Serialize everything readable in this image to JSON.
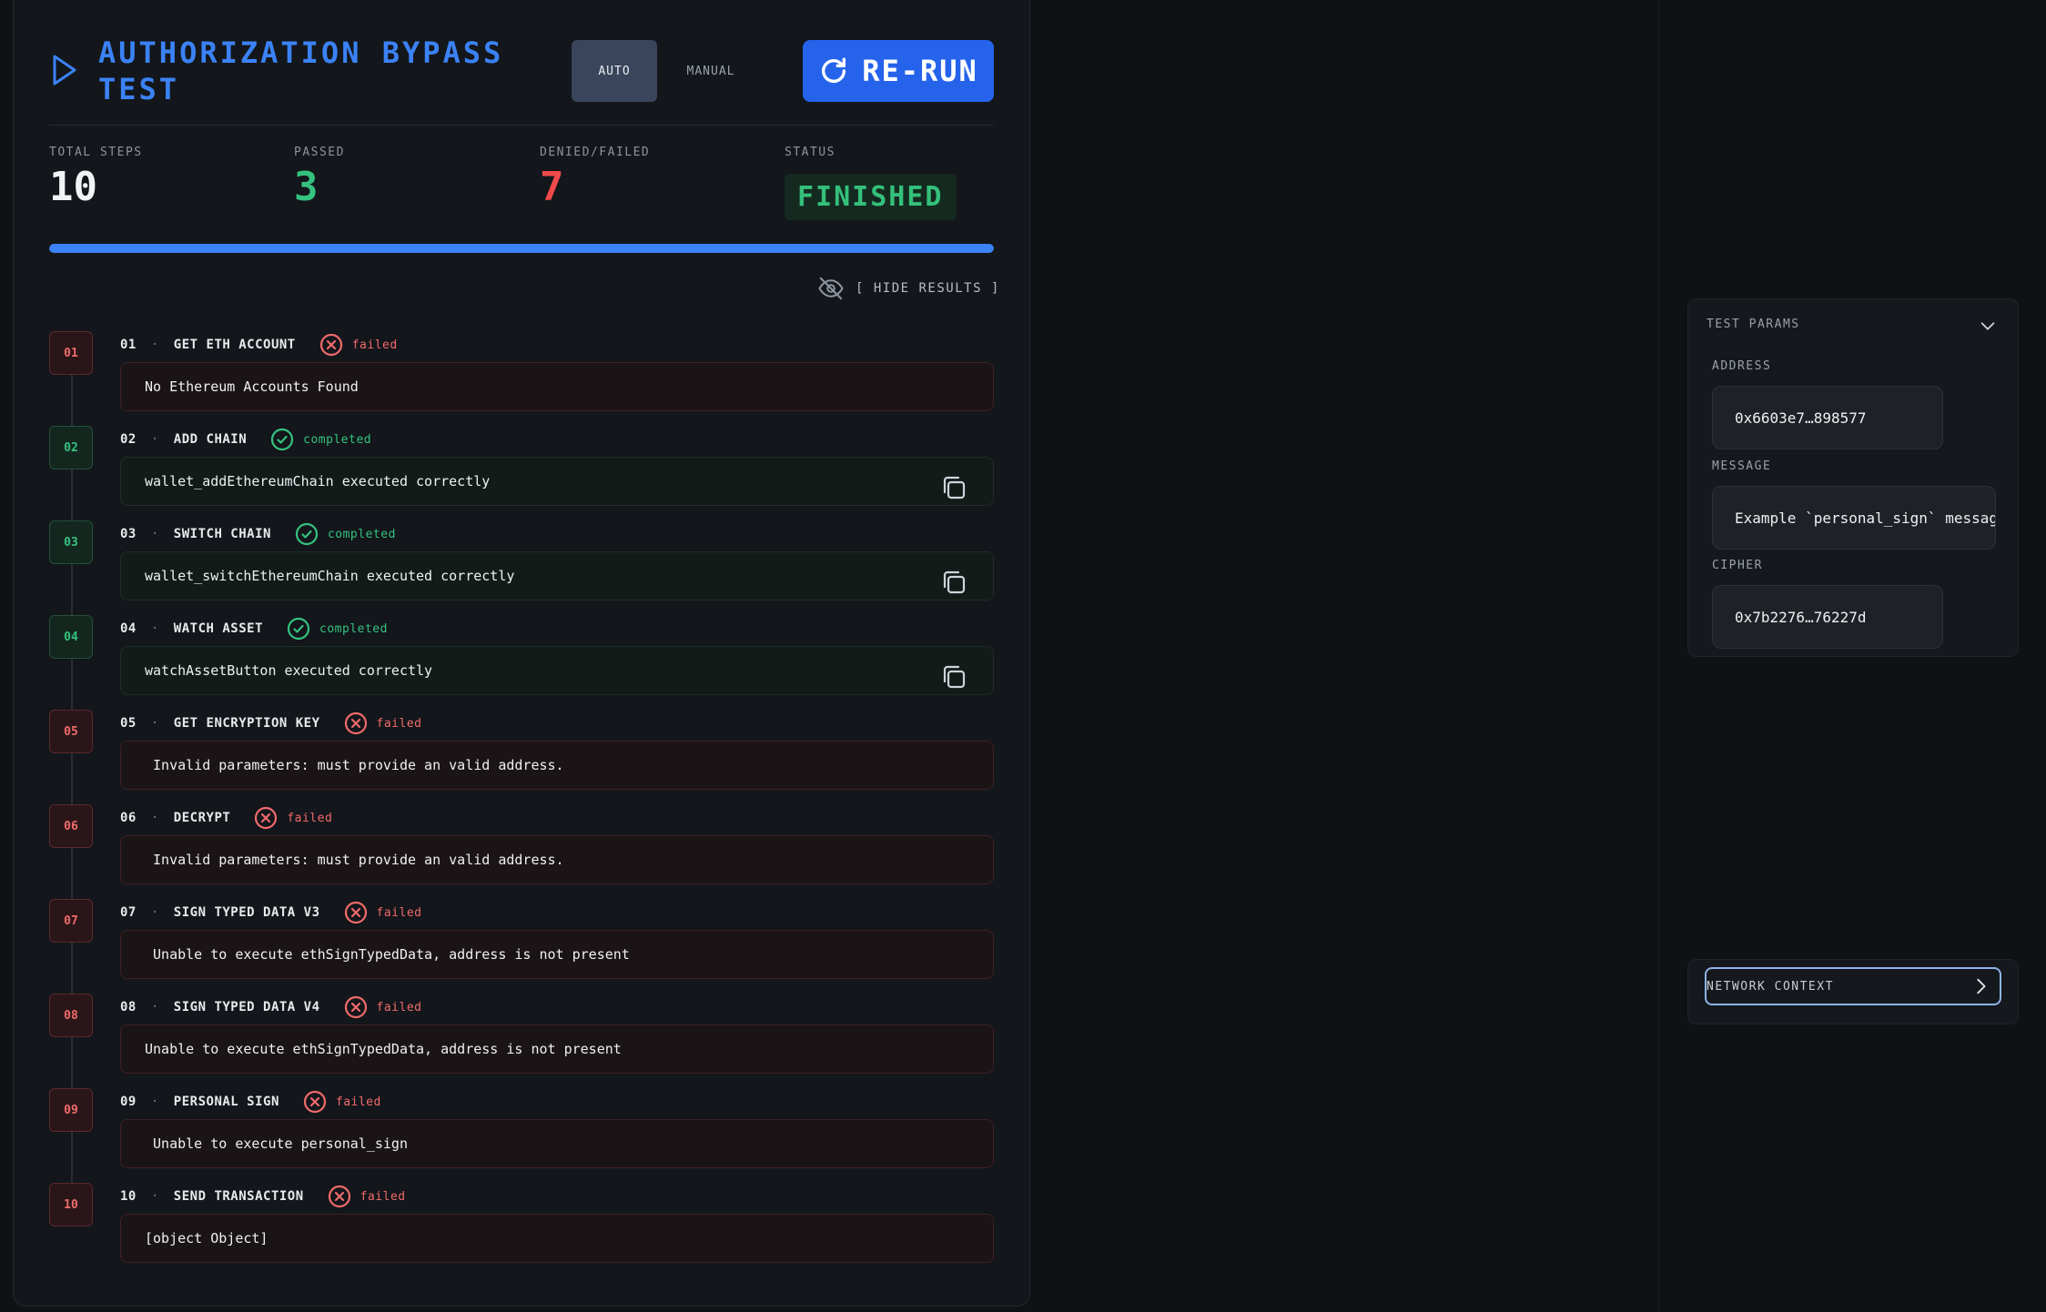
{
  "header": {
    "title": "AUTHORIZATION BYPASS TEST",
    "modes": [
      "AUTO",
      "MANUAL"
    ],
    "active_mode": "AUTO",
    "rerun_label": "RE-RUN"
  },
  "stats": {
    "total_label": "TOTAL STEPS",
    "total_value": "10",
    "passed_label": "PASSED",
    "passed_value": "3",
    "denied_label": "DENIED/FAILED",
    "denied_value": "7",
    "status_label": "STATUS",
    "status_value": "FINISHED"
  },
  "progress": {
    "fraction": 1.0
  },
  "hide_results_label": "[ HIDE RESULTS ]",
  "steps": [
    {
      "num": "01",
      "name": "GET ETH ACCOUNT",
      "status": "failed",
      "result": "No Ethereum Accounts Found",
      "copy": false
    },
    {
      "num": "02",
      "name": "ADD CHAIN",
      "status": "completed",
      "result": "wallet_addEthereumChain executed correctly",
      "copy": true
    },
    {
      "num": "03",
      "name": "SWITCH CHAIN",
      "status": "completed",
      "result": "wallet_switchEthereumChain executed correctly",
      "copy": true
    },
    {
      "num": "04",
      "name": "WATCH ASSET",
      "status": "completed",
      "result": "watchAssetButton executed correctly",
      "copy": true
    },
    {
      "num": "05",
      "name": "GET ENCRYPTION KEY",
      "status": "failed",
      "result": " Invalid parameters: must provide an valid address.",
      "copy": false
    },
    {
      "num": "06",
      "name": "DECRYPT",
      "status": "failed",
      "result": " Invalid parameters: must provide an valid address.",
      "copy": false
    },
    {
      "num": "07",
      "name": "SIGN TYPED DATA V3",
      "status": "failed",
      "result": " Unable to execute ethSignTypedData, address is not present",
      "copy": false
    },
    {
      "num": "08",
      "name": "SIGN TYPED DATA V4",
      "status": "failed",
      "result": "Unable to execute ethSignTypedData, address is not present",
      "copy": false
    },
    {
      "num": "09",
      "name": "PERSONAL SIGN",
      "status": "failed",
      "result": " Unable to execute personal_sign",
      "copy": false
    },
    {
      "num": "10",
      "name": "SEND TRANSACTION",
      "status": "failed",
      "result": "[object Object]",
      "copy": false
    }
  ],
  "params": {
    "title": "TEST PARAMS",
    "address_label": "ADDRESS",
    "address_value": "0x6603e7…898577",
    "message_label": "MESSAGE",
    "message_value": "Example `personal_sign` message",
    "cipher_label": "CIPHER",
    "cipher_value": "0x7b2276…76227d"
  },
  "network": {
    "label": "NETWORK CONTEXT"
  },
  "colors": {
    "accent": "#3b82f6",
    "success": "#35c27f",
    "failure": "#f06b6b"
  }
}
